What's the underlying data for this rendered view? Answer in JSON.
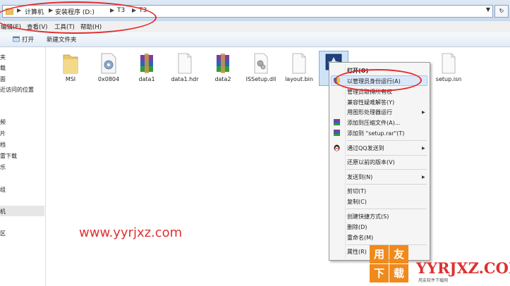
{
  "address_bar": {
    "crumbs": [
      "计算机",
      "安装程序 (D:)",
      "T3",
      "T3"
    ]
  },
  "menu": {
    "items": [
      "编辑(E)",
      "查看(V)",
      "工具(T)",
      "帮助(H)"
    ]
  },
  "toolbar": {
    "open_label": "打开",
    "new_folder_label": "新建文件夹"
  },
  "nav": {
    "items": [
      "夹",
      "载",
      "面",
      "近访问的位置",
      "频",
      "片",
      "档",
      "雷下载",
      "乐",
      "组",
      "机",
      "区"
    ]
  },
  "files": [
    {
      "name": "MSI",
      "icon": "folder-icon"
    },
    {
      "name": "0x0804",
      "icon": "settings-file-icon"
    },
    {
      "name": "data1",
      "icon": "winrar-archive-icon"
    },
    {
      "name": "data1.hdr",
      "icon": "blank-file-icon"
    },
    {
      "name": "data2",
      "icon": "winrar-archive-icon"
    },
    {
      "name": "ISSetup.dll",
      "icon": "dll-file-icon"
    },
    {
      "name": "layout.bin",
      "icon": "blank-file-icon"
    },
    {
      "name": "s",
      "icon": "setup-exe-icon"
    },
    {
      "name": "setup.isn",
      "icon": "blank-file-icon"
    }
  ],
  "context_menu": {
    "items": [
      "打开(O)",
      "以管理员身份运行(A)",
      "管理员取得所有权",
      "兼容性疑难解答(Y)",
      "用图形处理器运行",
      "添加到压缩文件(A)...",
      "添加到 \"setup.rar\"(T)",
      "通过QQ发送到",
      "还原以前的版本(V)",
      "发送到(N)",
      "剪切(T)",
      "复制(C)",
      "创建快捷方式(S)",
      "删除(D)",
      "重命名(M)",
      "属性(R)"
    ]
  },
  "watermark": {
    "url": "www.yyrjxz.com",
    "logo_tiles": [
      "用",
      "友",
      "下",
      "载"
    ],
    "brand": "YYRJXZ.COM",
    "sub": "用友软件下载网"
  },
  "colors": {
    "annotation_red": "#e32b2b",
    "highlight": "#d9e8fb",
    "logo_orange": "#f08a1c"
  }
}
